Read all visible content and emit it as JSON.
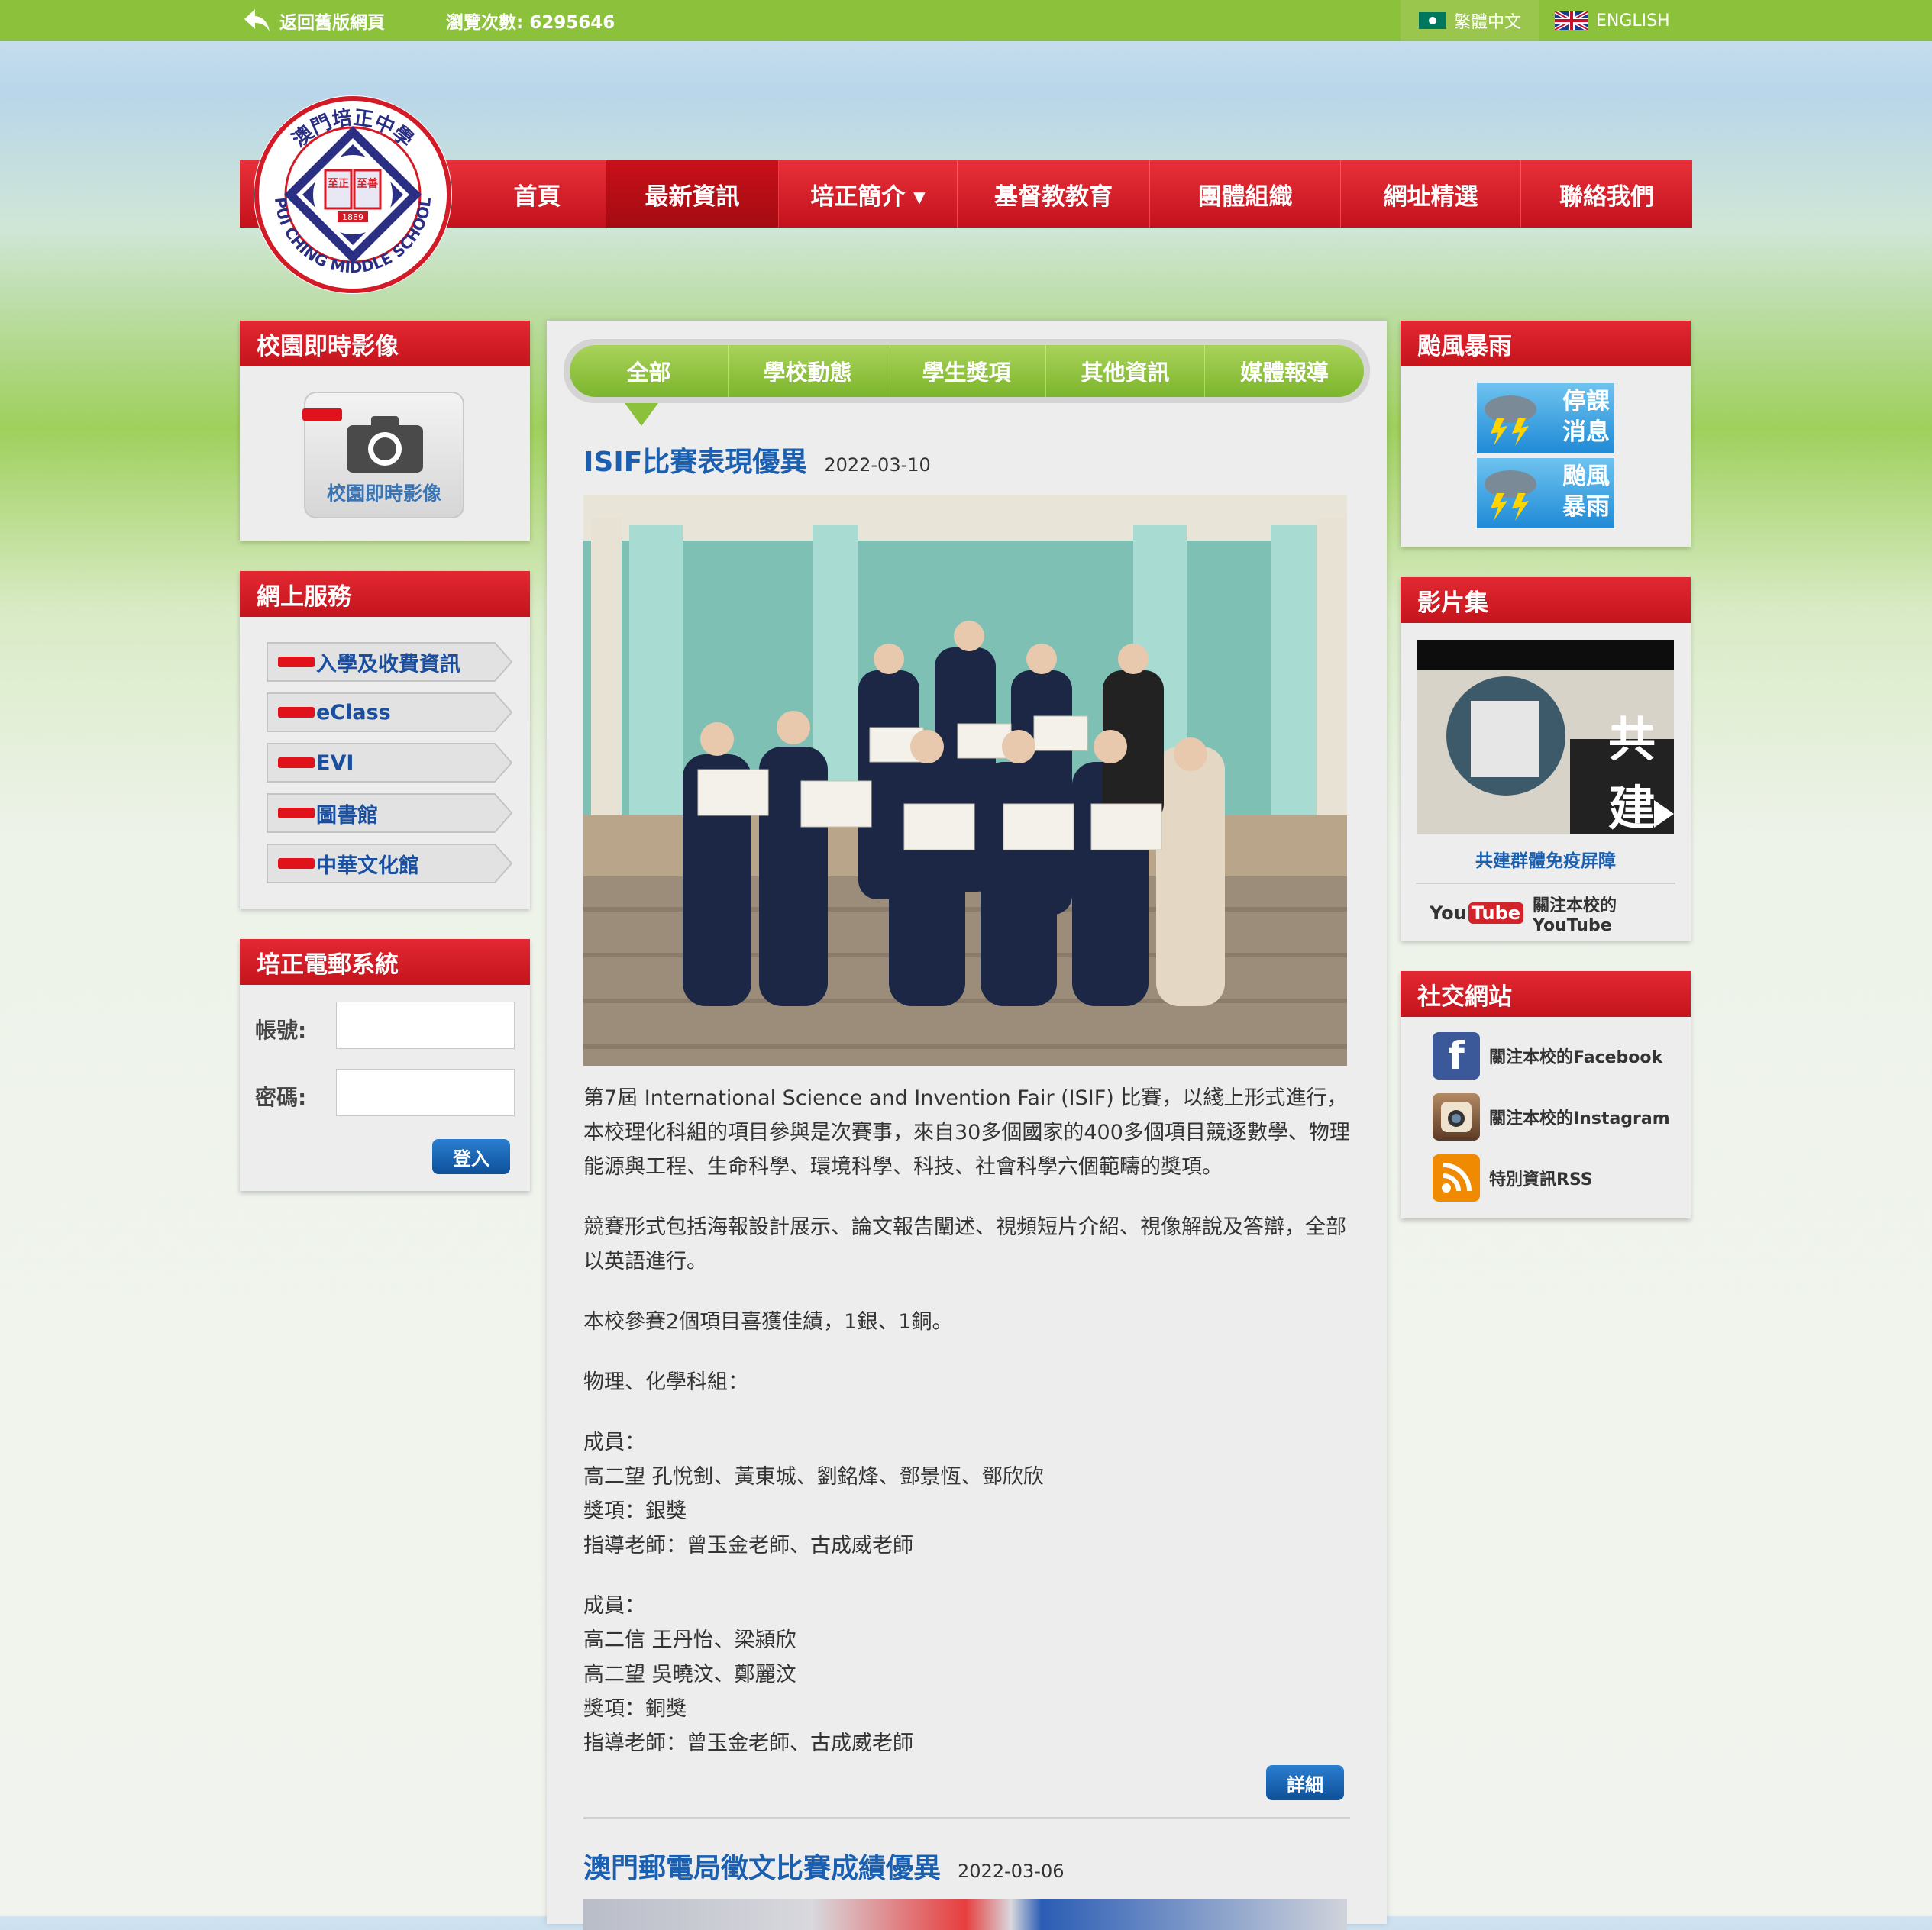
{
  "topbar": {
    "back_label": "返回舊版網頁",
    "views_label": "瀏覽次數: 6295646",
    "lang_tc": "繁體中文",
    "lang_en": "ENGLISH"
  },
  "nav": {
    "items": [
      {
        "label": "首頁"
      },
      {
        "label": "最新資訊"
      },
      {
        "label": "培正簡介 ▾"
      },
      {
        "label": "基督教教育"
      },
      {
        "label": "團體組織"
      },
      {
        "label": "網址精選"
      },
      {
        "label": "聯絡我們"
      }
    ],
    "active_index": 1
  },
  "camera_panel": {
    "title": "校園即時影像",
    "button_label": "校園即時影像"
  },
  "services_panel": {
    "title": "網上服務",
    "items": [
      {
        "label": "入學及收費資訊"
      },
      {
        "label": "eClass"
      },
      {
        "label": "EVI"
      },
      {
        "label": "圖書館"
      },
      {
        "label": "中華文化館"
      }
    ]
  },
  "mail_panel": {
    "title": "培正電郵系統",
    "account_label": "帳號:",
    "password_label": "密碼:",
    "login_label": "登入"
  },
  "typhoon_panel": {
    "title": "颱風暴雨",
    "btn1_line1": "停課",
    "btn1_line2": "消息",
    "btn2_line1": "颱風",
    "btn2_line2": "暴雨"
  },
  "video_panel": {
    "title": "影片集",
    "thumb_text": "共建",
    "video_title": "共建群體免疫屏障",
    "youtube_label": "關注本校的YouTube",
    "yt_you": "You",
    "yt_tube": "Tube"
  },
  "social_panel": {
    "title": "社交網站",
    "items": [
      {
        "label": "關注本校的Facebook",
        "icon": "facebook-icon",
        "color": "#3b5998"
      },
      {
        "label": "關注本校的Instagram",
        "icon": "instagram-icon",
        "color": "#8a5a3c"
      },
      {
        "label": "特別資訊RSS",
        "icon": "rss-icon",
        "color": "#f08a00"
      }
    ]
  },
  "tabs": [
    {
      "label": "全部"
    },
    {
      "label": "學校動態"
    },
    {
      "label": "學生獎項"
    },
    {
      "label": "其他資訊"
    },
    {
      "label": "媒體報導"
    }
  ],
  "post1": {
    "title": "ISIF比賽表現優異",
    "date": "2022-03-10",
    "paragraphs": [
      "第7屆 International Science and Invention Fair (ISIF) 比賽，以綫上形式進行，本校理化科組的項目參與是次賽事，來自30多個國家的400多個項目競逐數學、物理能源與工程、生命科學、環境科學、科技、社會科學六個範疇的獎項。",
      "競賽形式包括海報設計展示、論文報告闡述、視頻短片介紹、視像解說及答辯，全部以英語進行。",
      "本校參賽2個項目喜獲佳績，1銀、1銅。",
      "物理、化學科組："
    ],
    "group1": [
      "成員：",
      "高二望 孔悅釗、黃東城、劉銘烽、鄧景恆、鄧欣欣",
      "獎項：銀獎",
      "指導老師：曾玉金老師、古成威老師"
    ],
    "group2": [
      "成員：",
      "高二信 王丹怡、梁潁欣",
      "高二望 吳曉汶、鄭麗汶",
      "獎項：銅獎",
      "指導老師：曾玉金老師、古成威老師"
    ],
    "details_label": "詳細"
  },
  "post2": {
    "title": "澳門郵電局徵文比賽成績優異",
    "date": "2022-03-06"
  },
  "logo": {
    "ring_text_top": "澳門培正中學",
    "ring_text_bottom": "PUI CHING MIDDLE SCHOOL",
    "book_left": "至正",
    "book_right": "至善",
    "year": "1889"
  },
  "colors": {
    "topbar": "#8cc23b",
    "nav_red": "#d41e27",
    "link_blue": "#1a5fb0",
    "tab_green": "#8cc23b"
  }
}
